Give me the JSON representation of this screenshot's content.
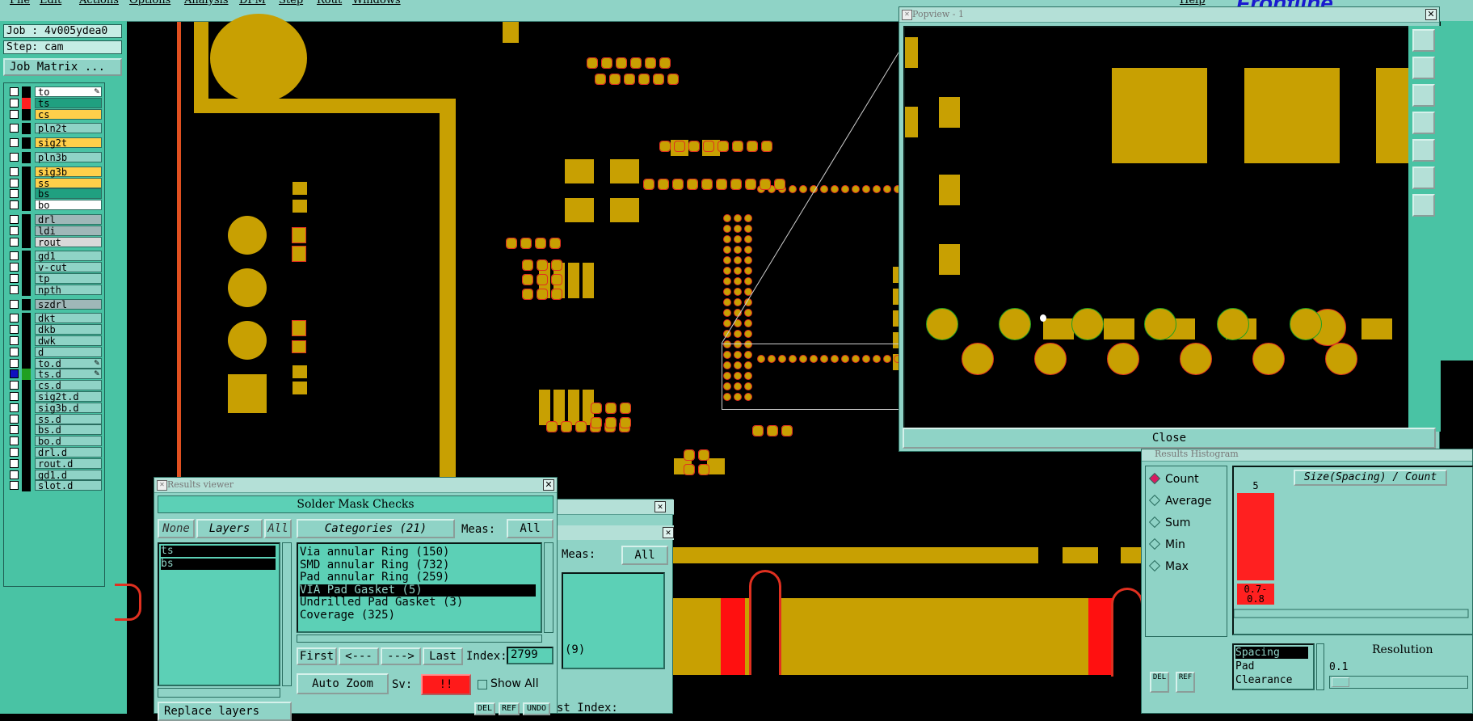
{
  "menubar": {
    "items": [
      "File",
      "Edit",
      "Actions",
      "Options",
      "Analysis",
      "DFM",
      "Step",
      "Rout",
      "Windows"
    ],
    "help": "Help",
    "brand": "Frontline"
  },
  "left_panel": {
    "job": "Job : 4v005ydea0",
    "step": "Step: cam",
    "job_matrix_button": "Job Matrix ...",
    "layers": [
      {
        "name": "to",
        "swatch": "#000000",
        "bg": "#ffffff",
        "editable": true
      },
      {
        "name": "ts",
        "swatch": "#ff2020",
        "bg": "#20a080"
      },
      {
        "name": "cs",
        "swatch": "#000000",
        "bg": "#ffcf4a"
      },
      {
        "name": "pln2t",
        "swatch": "#000000",
        "bg": "#8fd3c6",
        "gap": true
      },
      {
        "name": "sig2t",
        "swatch": "#000000",
        "bg": "#ffcf4a",
        "gap": true
      },
      {
        "name": "pln3b",
        "swatch": "#000000",
        "bg": "#8fd3c6",
        "gap": true
      },
      {
        "name": "sig3b",
        "swatch": "#000000",
        "bg": "#ffcf4a",
        "gap": true
      },
      {
        "name": "ss",
        "swatch": "#000000",
        "bg": "#ffcf4a"
      },
      {
        "name": "bs",
        "swatch": "#000000",
        "bg": "#20a080"
      },
      {
        "name": "bo",
        "swatch": "#000000",
        "bg": "#ffffff"
      },
      {
        "name": "drl",
        "swatch": "#000000",
        "bg": "#9fb7b8",
        "gap": true
      },
      {
        "name": "ldi",
        "swatch": "#000000",
        "bg": "#9fb7b8"
      },
      {
        "name": "rout",
        "swatch": "#000000",
        "bg": "#d9d9d9"
      },
      {
        "name": "gd1",
        "swatch": "#000000",
        "bg": "#8fd3c6",
        "gap": true
      },
      {
        "name": "v-cut",
        "swatch": "#000000",
        "bg": "#8fd3c6"
      },
      {
        "name": "tp",
        "swatch": "#000000",
        "bg": "#8fd3c6"
      },
      {
        "name": "npth",
        "swatch": "#000000",
        "bg": "#8fd3c6"
      },
      {
        "name": "szdrl",
        "swatch": "#000000",
        "bg": "#9fb7b8",
        "gap": true
      },
      {
        "name": "dkt",
        "swatch": "#000000",
        "bg": "#8fd3c6",
        "gap": true
      },
      {
        "name": "dkb",
        "swatch": "#000000",
        "bg": "#8fd3c6"
      },
      {
        "name": "dwk",
        "swatch": "#000000",
        "bg": "#8fd3c6"
      },
      {
        "name": "d",
        "swatch": "#000000",
        "bg": "#8fd3c6"
      },
      {
        "name": "to.d",
        "swatch": "#000000",
        "bg": "#8fd3c6",
        "editable": true
      },
      {
        "name": "ts.d",
        "swatch": "#20a020",
        "bg": "#8fd3c6",
        "checked": true,
        "editable": true
      },
      {
        "name": "cs.d",
        "swatch": "#000000",
        "bg": "#8fd3c6"
      },
      {
        "name": "sig2t.d",
        "swatch": "#000000",
        "bg": "#8fd3c6"
      },
      {
        "name": "sig3b.d",
        "swatch": "#000000",
        "bg": "#8fd3c6"
      },
      {
        "name": "ss.d",
        "swatch": "#000000",
        "bg": "#8fd3c6"
      },
      {
        "name": "bs.d",
        "swatch": "#000000",
        "bg": "#8fd3c6"
      },
      {
        "name": "bo.d",
        "swatch": "#000000",
        "bg": "#8fd3c6"
      },
      {
        "name": "drl.d",
        "swatch": "#000000",
        "bg": "#8fd3c6"
      },
      {
        "name": "rout.d",
        "swatch": "#000000",
        "bg": "#8fd3c6"
      },
      {
        "name": "gd1.d",
        "swatch": "#000000",
        "bg": "#8fd3c6"
      },
      {
        "name": "slot.d",
        "swatch": "#000000",
        "bg": "#8fd3c6"
      }
    ]
  },
  "popview": {
    "title": "Popview - 1",
    "close_button": "Close"
  },
  "results_viewer": {
    "title": "Results viewer",
    "header": "Solder Mask Checks",
    "none_button": "None",
    "layers_label": "Layers",
    "all_button": "All",
    "layers": [
      "ts",
      "bs"
    ],
    "categories_label": "Categories (21)",
    "meas_label": "Meas:",
    "meas_value": "All",
    "categories": [
      "Via annular Ring (150)",
      "SMD annular Ring (732)",
      "Pad annular Ring (259)",
      "VIA Pad Gasket (5)",
      "Undrilled Pad Gasket (3)",
      "Coverage (325)"
    ],
    "selected_category": "VIA Pad Gasket (5)",
    "first_button": "First",
    "prev_button": "<---",
    "next_button": "--->",
    "last_button": "Last",
    "index_label": "Index:",
    "index_value": "2799",
    "auto_zoom": "Auto Zoom",
    "sv_label": "Sv:",
    "sv_value": "!!",
    "show_all": "Show All",
    "replace_layers": "Replace layers",
    "del": "DEL",
    "ref": "REF",
    "undo": "UNDO"
  },
  "back_window": {
    "meas_label": "Meas:",
    "meas_value": "All",
    "count_text": "(9)",
    "index_label": "st Index:"
  },
  "histogram": {
    "title": "Results Histogram",
    "options": [
      "Count",
      "Average",
      "Sum",
      "Min",
      "Max"
    ],
    "selected": "Count",
    "chart_title": "Size(Spacing) / Count",
    "del": "DEL",
    "ref": "REF",
    "measure_list": [
      "Spacing",
      "Pad",
      "Clearance"
    ],
    "resolution_label": "Resolution",
    "resolution_value": "0.1"
  },
  "chart_data": {
    "type": "bar",
    "title": "Size(Spacing) / Count",
    "categories": [
      "0.7-\n0.8"
    ],
    "values": [
      5
    ],
    "color": "#ff2020"
  }
}
